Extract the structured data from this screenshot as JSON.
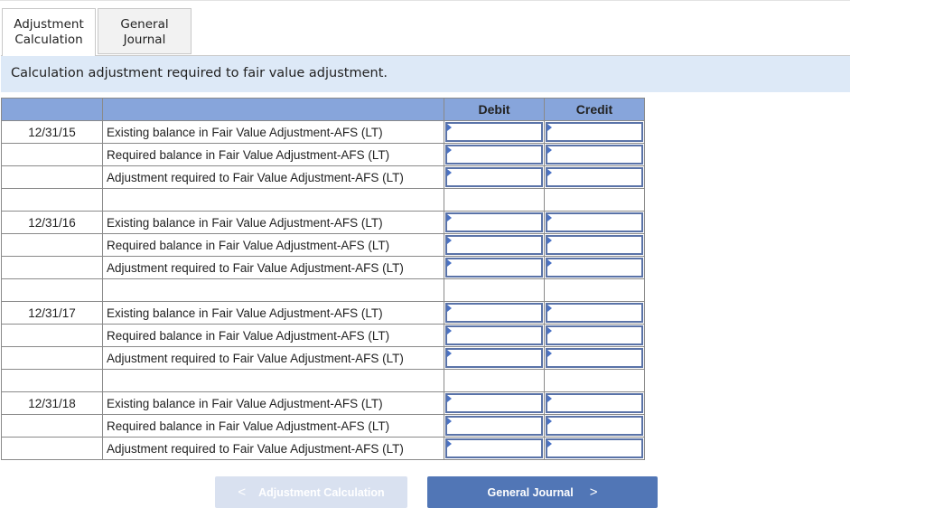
{
  "tabs": [
    {
      "label_line1": "Adjustment",
      "label_line2": "Calculation",
      "active": true
    },
    {
      "label_line1": "General",
      "label_line2": "Journal",
      "active": false
    }
  ],
  "banner": "Calculation adjustment required to fair value adjustment.",
  "table": {
    "headers": [
      "",
      "",
      "Debit",
      "Credit"
    ],
    "groups": [
      {
        "date": "12/31/15",
        "rows": [
          {
            "label": "Existing balance in Fair Value Adjustment-AFS (LT)",
            "debit": "",
            "credit": ""
          },
          {
            "label": "Required balance in Fair Value Adjustment-AFS (LT)",
            "debit": "",
            "credit": ""
          },
          {
            "label": "Adjustment required to Fair Value Adjustment-AFS (LT)",
            "debit": "",
            "credit": ""
          }
        ]
      },
      {
        "date": "12/31/16",
        "rows": [
          {
            "label": "Existing balance in Fair Value Adjustment-AFS (LT)",
            "debit": "",
            "credit": ""
          },
          {
            "label": "Required balance in Fair Value Adjustment-AFS (LT)",
            "debit": "",
            "credit": ""
          },
          {
            "label": "Adjustment required to Fair Value Adjustment-AFS (LT)",
            "debit": "",
            "credit": ""
          }
        ]
      },
      {
        "date": "12/31/17",
        "rows": [
          {
            "label": "Existing balance in Fair Value Adjustment-AFS (LT)",
            "debit": "",
            "credit": ""
          },
          {
            "label": "Required balance in Fair Value Adjustment-AFS (LT)",
            "debit": "",
            "credit": ""
          },
          {
            "label": "Adjustment required to Fair Value Adjustment-AFS (LT)",
            "debit": "",
            "credit": ""
          }
        ]
      },
      {
        "date": "12/31/18",
        "rows": [
          {
            "label": "Existing balance in Fair Value Adjustment-AFS (LT)",
            "debit": "",
            "credit": ""
          },
          {
            "label": "Required balance in Fair Value Adjustment-AFS (LT)",
            "debit": "",
            "credit": ""
          },
          {
            "label": "Adjustment required to Fair Value Adjustment-AFS (LT)",
            "debit": "",
            "credit": ""
          }
        ]
      }
    ]
  },
  "nav": {
    "prev_label": "Adjustment Calculation",
    "prev_icon": "chevron-left-icon",
    "prev_disabled": true,
    "next_label": "General Journal",
    "next_icon": "chevron-right-icon"
  },
  "colors": {
    "header_bg": "#87a5db",
    "banner_bg": "#dde9f7",
    "input_border": "#5a73a8",
    "next_button": "#5176b6",
    "prev_button_disabled": "#d9e1f0"
  }
}
